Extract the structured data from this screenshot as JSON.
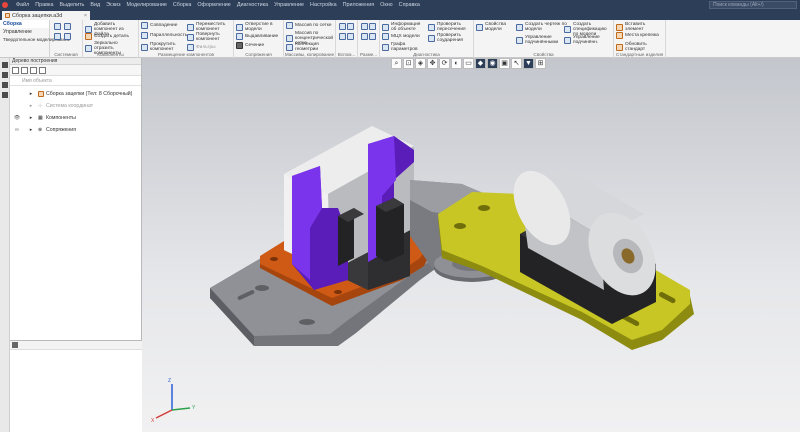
{
  "menu": {
    "items": [
      "Файл",
      "Правка",
      "Выделить",
      "Вид",
      "Эскиз",
      "Моделирование",
      "Сборка",
      "Оформление",
      "Диагностика",
      "Управление",
      "Настройка",
      "Приложения",
      "Окно",
      "Справка"
    ],
    "search_placeholder": "Поиск команды (Alt+/)"
  },
  "document": {
    "tab_label": "Сборка зацепки.a3d",
    "close": "×"
  },
  "ribbon": {
    "left_tabs": [
      "Сборка",
      "Управление",
      "Твердотельное моделирование"
    ],
    "groups": [
      {
        "label": "Системная",
        "items": []
      },
      {
        "label": "Компоненты",
        "items": [
          "Добавить компонент из файла",
          "Создать деталь",
          "Зеркально отразить компоненты"
        ]
      },
      {
        "label": "Размещение компонентов",
        "items": [
          "Совпадение",
          "Переместить компонент",
          "Параллельность",
          "Повернуть компонент",
          "Прокрутить компонент",
          "Фильтры"
        ]
      },
      {
        "label": "Сопряжения",
        "items": [
          "Отверстие в модели",
          "Выдавливание",
          "Сечение"
        ]
      },
      {
        "label": "Массивы, копирование",
        "items": [
          "Массив по сетке",
          "Массив по концентрической сетке",
          "Коллекция геометрии"
        ]
      },
      {
        "label": "Вспом...",
        "items": []
      },
      {
        "label": "Разме...",
        "items": []
      },
      {
        "label": "Диагностика",
        "items": [
          "Информация об объекте",
          "МЦХ модели",
          "Проверить пересечения",
          "Проверить соударения",
          "Графа параметров"
        ]
      },
      {
        "label": "Свойства",
        "items": [
          "Свойства модели",
          "Создать чертеж по модели",
          "Управление подчинёнными",
          "Создать спецификацию по модели",
          "Управление подчинённ. "
        ]
      },
      {
        "label": "Стандартные изделия",
        "items": [
          "Вставить элемент",
          "Места крепежа",
          "Обновить стандарт"
        ]
      }
    ]
  },
  "tree": {
    "panel_title": "Дерево построения",
    "filter_placeholder": "Имя объекта",
    "rows": [
      {
        "label": "Сборка зацепки (Тел: 8 Сборочный)",
        "dim": false
      },
      {
        "label": "Система координат",
        "dim": true
      },
      {
        "label": "Компоненты",
        "dim": false
      },
      {
        "label": "Сопряжения",
        "dim": false
      }
    ]
  },
  "axis_labels": {
    "x": "X",
    "y": "Y",
    "z": "Z"
  },
  "colors": {
    "titlebar": "#2d3e58",
    "accent": "#1b4f9c",
    "part_purple": "#6a24d6",
    "part_orange": "#cf5a16",
    "part_yellow": "#c8c624",
    "part_gray": "#8a8b90"
  }
}
